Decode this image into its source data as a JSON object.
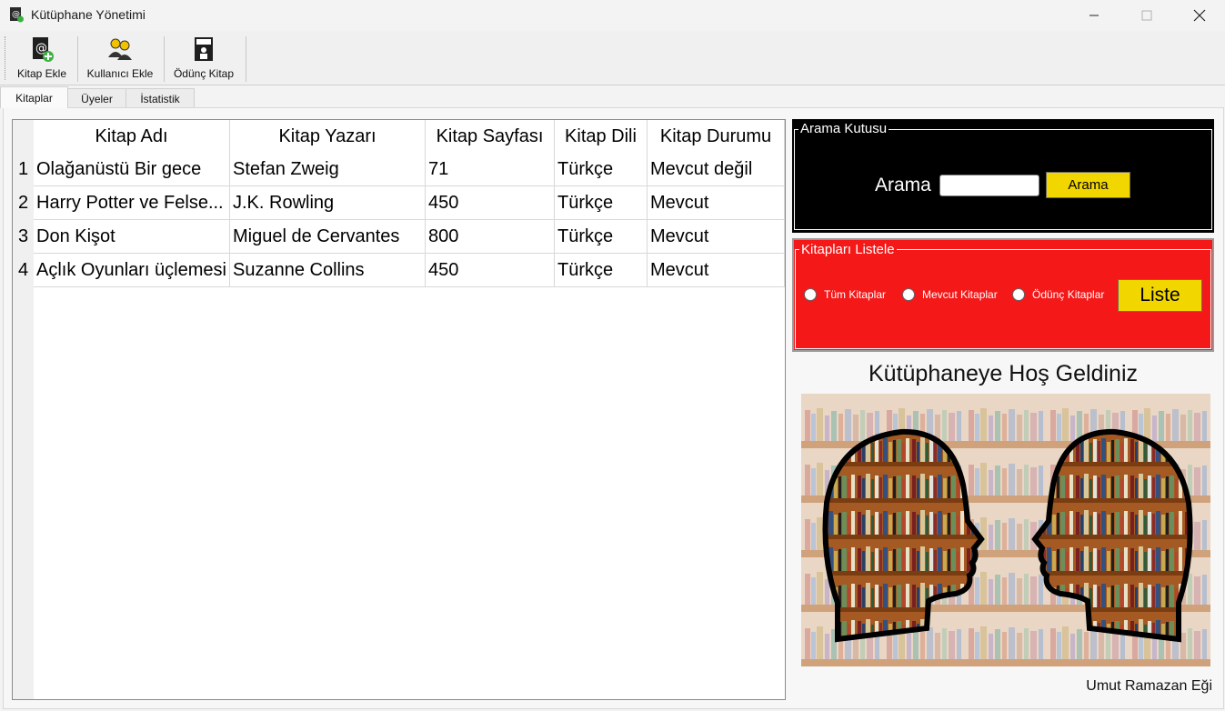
{
  "window": {
    "title": "Kütüphane Yönetimi"
  },
  "toolbar": {
    "buttons": [
      {
        "label": "Kitap Ekle",
        "icon": "add-book-icon"
      },
      {
        "label": "Kullanıcı Ekle",
        "icon": "users-icon"
      },
      {
        "label": "Ödünç Kitap",
        "icon": "lend-book-icon"
      }
    ]
  },
  "tabs": [
    {
      "label": "Kitaplar",
      "active": true
    },
    {
      "label": "Üyeler",
      "active": false
    },
    {
      "label": "İstatistik",
      "active": false
    }
  ],
  "books_table": {
    "columns": [
      "Kitap Adı",
      "Kitap Yazarı",
      "Kitap Sayfası",
      "Kitap Dili",
      "Kitap Durumu"
    ],
    "rows": [
      {
        "num": "1",
        "cells": [
          "Olağanüstü Bir gece",
          "Stefan Zweig",
          "71",
          "Türkçe",
          "Mevcut değil"
        ]
      },
      {
        "num": "2",
        "cells": [
          "Harry Potter ve Felse...",
          "J.K. Rowling",
          "450",
          "Türkçe",
          "Mevcut"
        ]
      },
      {
        "num": "3",
        "cells": [
          "Don Kişot",
          "Miguel de Cervantes",
          "800",
          "Türkçe",
          "Mevcut"
        ]
      },
      {
        "num": "4",
        "cells": [
          "Açlık Oyunları üçlemesi",
          "Suzanne Collins",
          "450",
          "Türkçe",
          "Mevcut"
        ]
      }
    ]
  },
  "search_group": {
    "title": "Arama Kutusu",
    "label": "Arama",
    "input_value": "",
    "button_label": "Arama",
    "background": "#000000",
    "button_color": "#f2d600"
  },
  "list_group": {
    "title": "Kitapları Listele",
    "options": [
      "Tüm Kitaplar",
      "Mevcut Kitaplar",
      "Ödünç Kitaplar"
    ],
    "button_label": "Liste",
    "background": "#f41818",
    "button_color": "#f2d600"
  },
  "welcome": {
    "text": "Kütüphaneye Hoş Geldiniz"
  },
  "author": {
    "text": "Umut Ramazan Eği"
  }
}
